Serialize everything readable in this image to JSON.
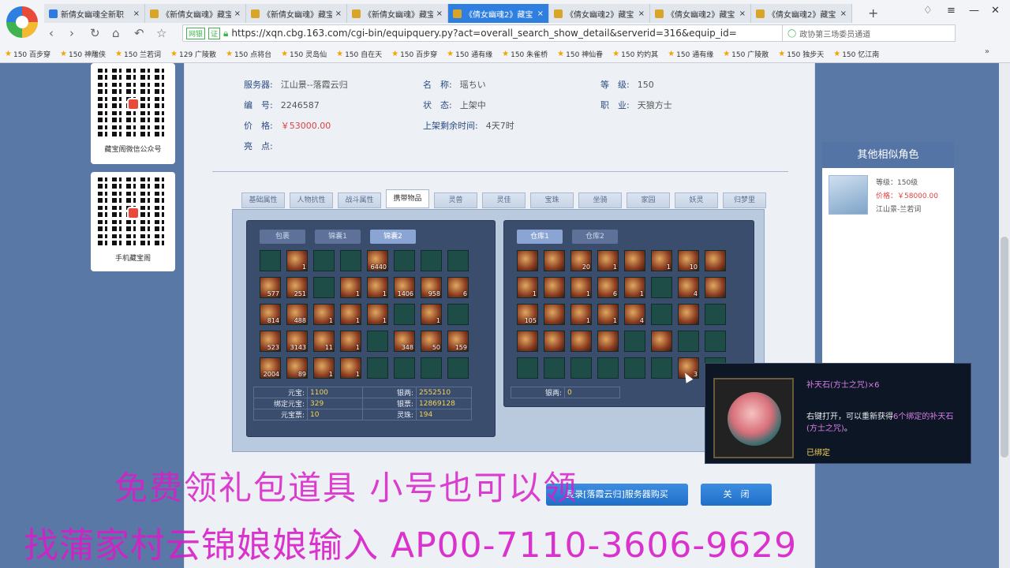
{
  "browser": {
    "tabs": [
      {
        "label": "新倩女幽魂全新职",
        "active": false
      },
      {
        "label": "《新倩女幽魂》藏宝",
        "active": false
      },
      {
        "label": "《新倩女幽魂》藏宝",
        "active": false
      },
      {
        "label": "《新倩女幽魂》藏宝",
        "active": false
      },
      {
        "label": "《倩女幽魂2》藏宝",
        "active": true
      },
      {
        "label": "《倩女幽魂2》藏宝",
        "active": false
      },
      {
        "label": "《倩女幽魂2》藏宝",
        "active": false
      },
      {
        "label": "《倩女幽魂2》藏宝",
        "active": false
      }
    ],
    "tab_close": "×",
    "new_tab": "+",
    "url_tag": "网银",
    "url_verify": "证",
    "url": "https://xqn.cbg.163.com/cgi-bin/equipquery.py?act=overall_search_show_detail&serverid=316&equip_id=",
    "search_text": "政协第三场委员通道",
    "bookmarks": [
      "150 百步穿",
      "150 神雕侠",
      "150 兰若词",
      "129 广陵散",
      "150 点将台",
      "150 灵岛仙",
      "150 自在天",
      "150 百步穿",
      "150 通有缘",
      "150 朱雀桥",
      "150 神仙眷",
      "150 妁妁其",
      "150 通有缘",
      "150 广陵散",
      "150 独步天",
      "150 忆江南"
    ],
    "bookmarks_more": "»"
  },
  "qr_cards": [
    {
      "caption": "藏宝阁微信公众号"
    },
    {
      "caption": "手机藏宝阁"
    }
  ],
  "character": {
    "server_label": "服务器:",
    "server": "江山景--落霞云归",
    "name_label": "名　称:",
    "name": "瑶ちい",
    "level_label": "等　级:",
    "level": "150",
    "id_label": "编　号:",
    "id": "2246587",
    "status_label": "状　态:",
    "status": "上架中",
    "class_label": "职　业:",
    "class": "天狼方士",
    "price_label": "价　格:",
    "price": "￥53000.00",
    "remaining_label": "上架剩余时间:",
    "remaining": "4天7时",
    "highlight_label": "亮　点:"
  },
  "main_tabs": [
    "基础属性",
    "人物抗性",
    "战斗属性",
    "携带物品",
    "灵兽",
    "灵佳",
    "宝珠",
    "坐骑",
    "家园",
    "妖灵",
    "归梦里"
  ],
  "active_main_tab": 3,
  "bag": {
    "tabs": [
      "包裹",
      "锦囊1",
      "锦囊2"
    ],
    "active_tab": 2,
    "items": [
      "",
      "1",
      "",
      "",
      "6440",
      "",
      "",
      "",
      "577",
      "251",
      "",
      "1",
      "1",
      "1406",
      "958",
      "6",
      "814",
      "488",
      "1",
      "1",
      "1",
      "",
      "1",
      "",
      "523",
      "3143",
      "11",
      "1",
      "",
      "348",
      "50",
      "159",
      "2004",
      "89",
      "1",
      "1",
      "",
      "",
      "",
      ""
    ],
    "filled": [
      false,
      true,
      false,
      false,
      true,
      false,
      false,
      false,
      true,
      true,
      false,
      true,
      true,
      true,
      true,
      true,
      true,
      true,
      true,
      true,
      true,
      false,
      true,
      false,
      true,
      true,
      true,
      true,
      false,
      true,
      true,
      true,
      true,
      true,
      true,
      true,
      false,
      false,
      false,
      false
    ],
    "stats": [
      [
        "元宝:",
        "1100",
        "银两:",
        "2552510"
      ],
      [
        "绑定元宝:",
        "329",
        "银票:",
        "12869128"
      ],
      [
        "元宝票:",
        "10",
        "灵珠:",
        "194"
      ]
    ]
  },
  "warehouse": {
    "tabs": [
      "仓库1",
      "仓库2"
    ],
    "active_tab": 0,
    "items": [
      "",
      "",
      "20",
      "1",
      "",
      "1",
      "10",
      "",
      "1",
      "",
      "1",
      "6",
      "1",
      "",
      "4",
      "",
      "105",
      "",
      "1",
      "1",
      "4",
      "",
      "",
      "",
      "",
      "",
      "",
      "",
      "",
      "",
      "",
      "",
      "",
      "",
      "",
      "",
      "",
      "",
      "3",
      ""
    ],
    "filled": [
      true,
      true,
      true,
      true,
      true,
      true,
      true,
      true,
      true,
      true,
      true,
      true,
      true,
      false,
      true,
      true,
      true,
      true,
      true,
      true,
      true,
      false,
      true,
      false,
      true,
      true,
      true,
      true,
      false,
      true,
      false,
      false,
      false,
      false,
      false,
      false,
      false,
      false,
      true,
      false
    ],
    "stats": [
      [
        "银两:",
        "0"
      ]
    ]
  },
  "tooltip": {
    "title": "补天石(方士之咒)×6",
    "desc_pre": "右键打开，可以重新获得",
    "desc_highlight1": "6个绑定的",
    "desc_highlight2": "补天石(方士之咒)",
    "desc_post": "。",
    "bound": "已绑定"
  },
  "similar": {
    "header": "其他相似角色",
    "level": "等级：150级",
    "price": "价格：￥58000.00",
    "server": "江山景-兰若词"
  },
  "buttons": {
    "login_buy": "登录[落霞云归]服务器购买",
    "close": "关　闭"
  },
  "promo": {
    "line1": "免费领礼包道具 小号也可以领",
    "line2": "找蒲家村云锦娘娘输入 AP00-7110-3606-9629"
  }
}
